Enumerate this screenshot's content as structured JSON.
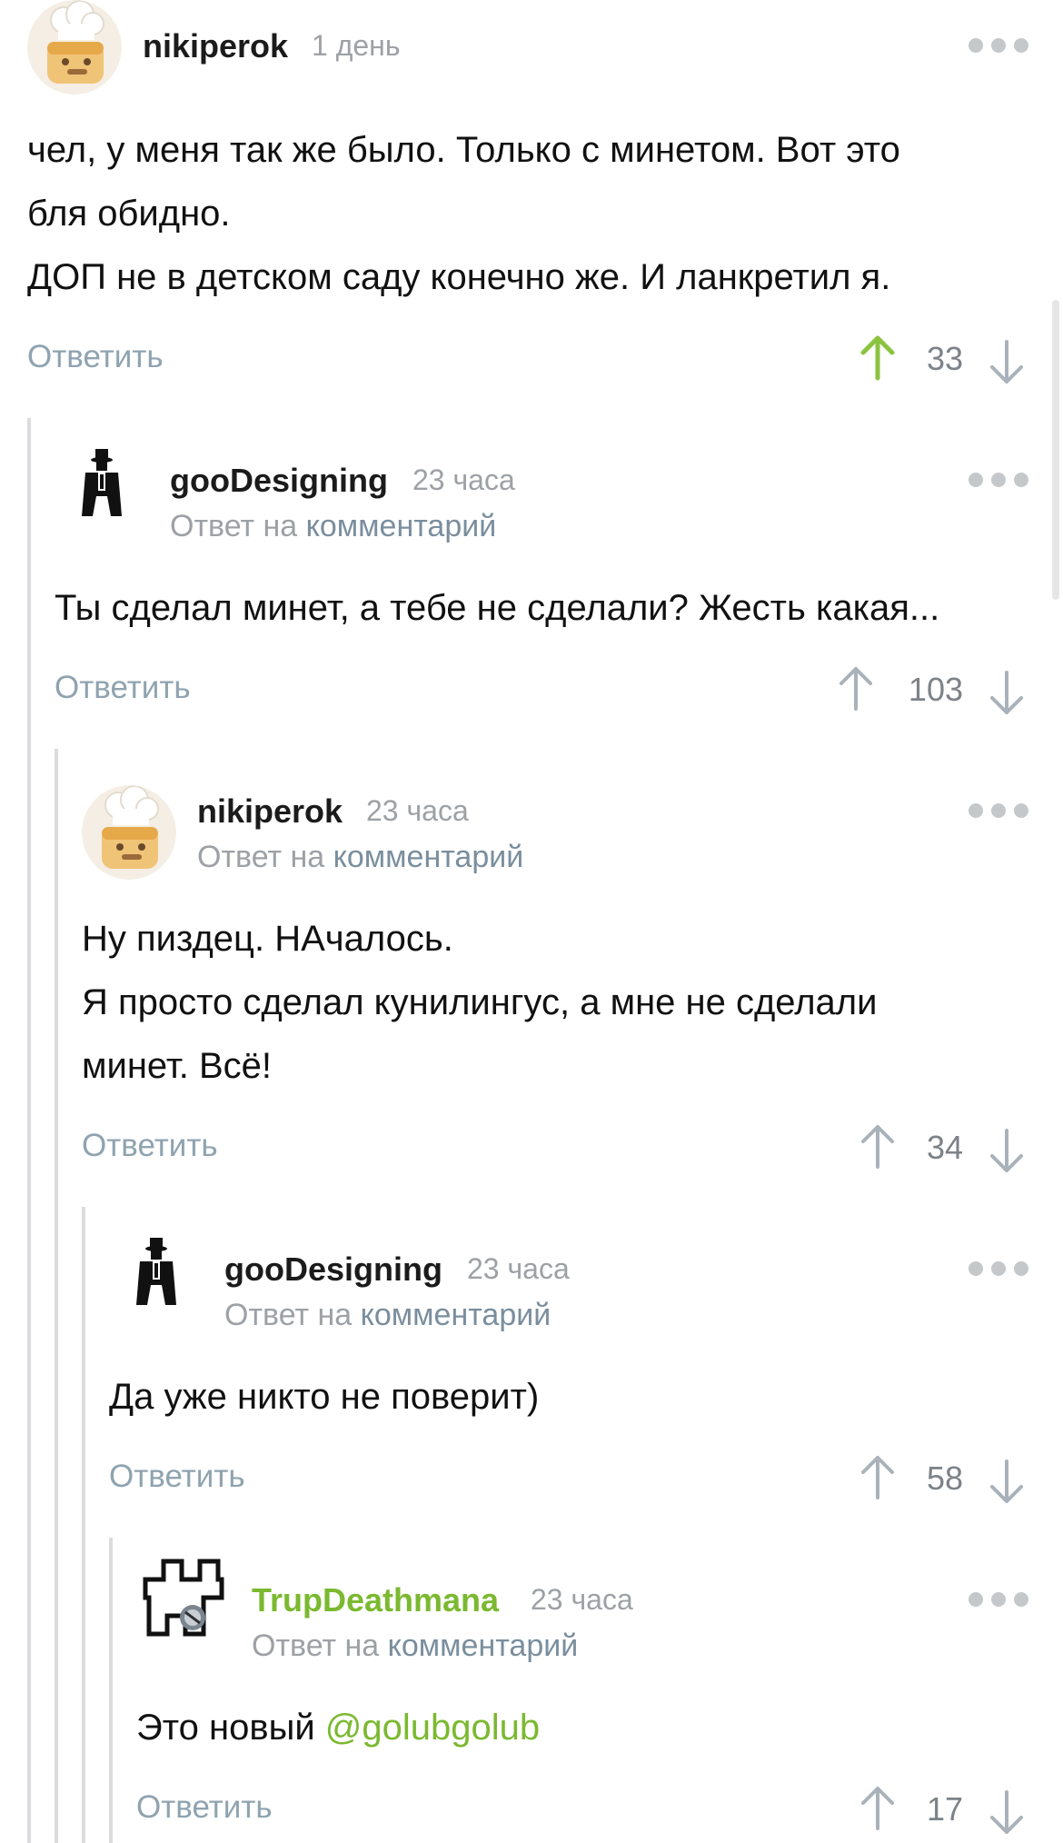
{
  "comments": [
    {
      "username": "nikiperok",
      "time": "1 день",
      "reply_prefix": "",
      "reply_link": "",
      "lines": [
        "чел, у меня так же было. Только с минетом. Вот это",
        "бля обидно.",
        "ДОП не в детском саду конечно же. И ланкретил я."
      ],
      "reply_label": "Ответить",
      "score": "33",
      "avatar_icon": "chef-hat-toast-avatar"
    },
    {
      "username": "gooDesigning",
      "time": "23 часа",
      "reply_prefix": "Ответ на",
      "reply_link": "комментарий",
      "lines": [
        "Ты сделал минет, а тебе не сделали? Жесть какая..."
      ],
      "reply_label": "Ответить",
      "score": "103",
      "avatar_icon": "man-in-hat-silhouette-avatar"
    },
    {
      "username": "nikiperok",
      "time": "23 часа",
      "reply_prefix": "Ответ на",
      "reply_link": "комментарий",
      "lines": [
        "Ну пиздец. НАчалось.",
        "Я просто сделал кунилингус, а мне не сделали",
        "минет. Всё!"
      ],
      "reply_label": "Ответить",
      "score": "34",
      "avatar_icon": "chef-hat-toast-avatar"
    },
    {
      "username": "gooDesigning",
      "time": "23 часа",
      "reply_prefix": "Ответ на",
      "reply_link": "комментарий",
      "lines": [
        "Да уже никто не поверит)"
      ],
      "reply_label": "Ответить",
      "score": "58",
      "avatar_icon": "man-in-hat-silhouette-avatar"
    },
    {
      "username": "TrupDeathmana",
      "time": "23 часа",
      "reply_prefix": "Ответ на",
      "reply_link": "комментарий",
      "lines_prefix": "Это новый ",
      "mention": "@golubgolub",
      "reply_label": "Ответить",
      "score": "17",
      "avatar_icon": "band-logo-avatar"
    }
  ],
  "colors": {
    "upvote_active": "#8ac43f",
    "vote_inactive": "#a9b2ba",
    "accent_green": "#7bb930",
    "thread_line": "#dadcdd"
  }
}
